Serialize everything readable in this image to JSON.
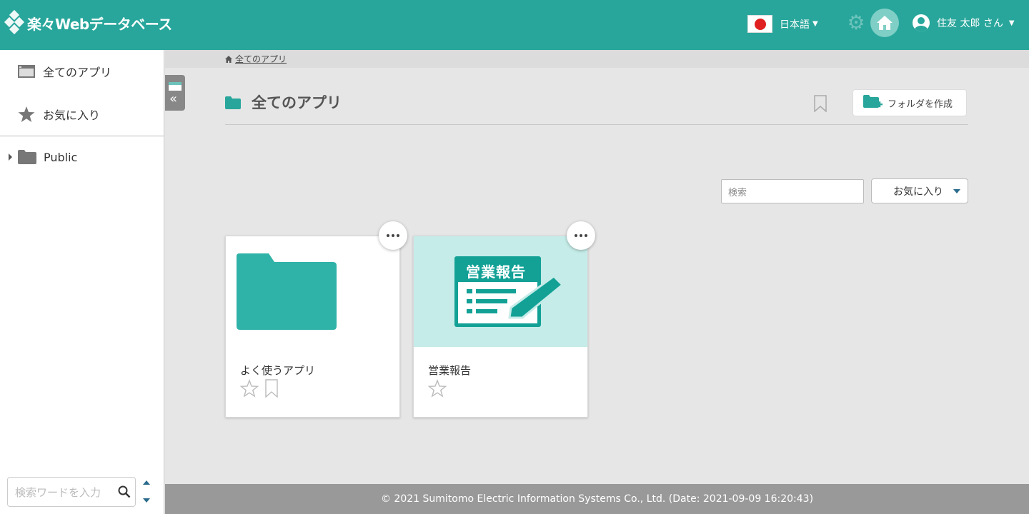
{
  "header": {
    "app_name": "楽々Webデータベース",
    "language": "日本語",
    "user": "住友 太郎 さん",
    "accent": "#28a69b"
  },
  "sidebar": {
    "items": [
      {
        "label": "全てのアプリ",
        "icon": "window-icon"
      },
      {
        "label": "お気に入り",
        "icon": "star-icon"
      }
    ],
    "tree": [
      {
        "label": "Public",
        "icon": "folder-icon"
      }
    ],
    "search_placeholder": "検索ワードを入力"
  },
  "breadcrumb": {
    "home_label": "全てのアプリ"
  },
  "main": {
    "title": "全てのアプリ",
    "create_folder_label": "フォルダを作成",
    "search_placeholder": "検索",
    "filter_selected": "お気に入り",
    "cards": [
      {
        "name": "よく使うアプリ",
        "type": "folder",
        "favorited": false,
        "bookmarked": false
      },
      {
        "name": "営業報告",
        "type": "app",
        "thumb_text": "営業報告",
        "favorited": false
      }
    ]
  },
  "footer": {
    "copyright": "© 2021 Sumitomo Electric Information Systems Co., Ltd. (Date: 2021-09-09 16:20:43)"
  }
}
